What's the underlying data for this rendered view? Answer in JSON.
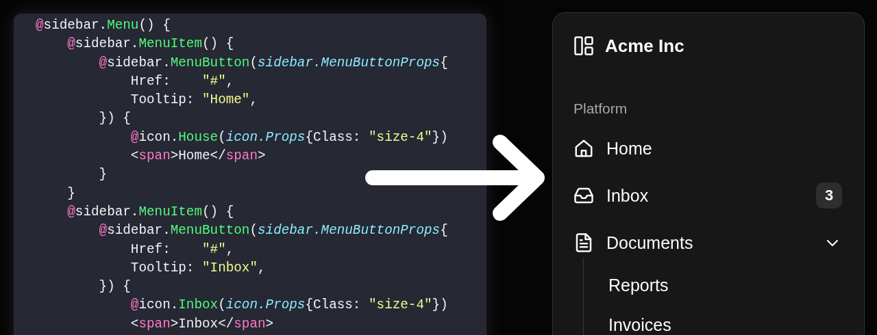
{
  "code_lines": [
    [
      {
        "kind": "at",
        "text": "@"
      },
      {
        "kind": "plain",
        "text": "sidebar."
      },
      {
        "kind": "fn",
        "text": "Menu"
      },
      {
        "kind": "plain",
        "text": "() {"
      }
    ],
    [
      {
        "kind": "at",
        "text": "    @"
      },
      {
        "kind": "plain",
        "text": "sidebar."
      },
      {
        "kind": "fn",
        "text": "MenuItem"
      },
      {
        "kind": "plain",
        "text": "() {"
      }
    ],
    [
      {
        "kind": "at",
        "text": "        @"
      },
      {
        "kind": "plain",
        "text": "sidebar."
      },
      {
        "kind": "fn",
        "text": "MenuButton"
      },
      {
        "kind": "plain",
        "text": "("
      },
      {
        "kind": "type",
        "text": "sidebar.MenuButtonProps"
      },
      {
        "kind": "plain",
        "text": "{"
      }
    ],
    [
      {
        "kind": "plain",
        "text": "            Href:    "
      },
      {
        "kind": "string",
        "text": "\"#\""
      },
      {
        "kind": "plain",
        "text": ","
      }
    ],
    [
      {
        "kind": "plain",
        "text": "            Tooltip: "
      },
      {
        "kind": "string",
        "text": "\"Home\""
      },
      {
        "kind": "plain",
        "text": ","
      }
    ],
    [
      {
        "kind": "plain",
        "text": "        }) {"
      }
    ],
    [
      {
        "kind": "at",
        "text": "            @"
      },
      {
        "kind": "plain",
        "text": "icon."
      },
      {
        "kind": "fn",
        "text": "House"
      },
      {
        "kind": "plain",
        "text": "("
      },
      {
        "kind": "type",
        "text": "icon.Props"
      },
      {
        "kind": "plain",
        "text": "{Class: "
      },
      {
        "kind": "string",
        "text": "\"size-4\""
      },
      {
        "kind": "plain",
        "text": "})"
      }
    ],
    [
      {
        "kind": "plain",
        "text": "            <"
      },
      {
        "kind": "tag",
        "text": "span"
      },
      {
        "kind": "plain",
        "text": ">Home</"
      },
      {
        "kind": "tag",
        "text": "span"
      },
      {
        "kind": "plain",
        "text": ">"
      }
    ],
    [
      {
        "kind": "plain",
        "text": "        }"
      }
    ],
    [
      {
        "kind": "plain",
        "text": "    }"
      }
    ],
    [
      {
        "kind": "at",
        "text": "    @"
      },
      {
        "kind": "plain",
        "text": "sidebar."
      },
      {
        "kind": "fn",
        "text": "MenuItem"
      },
      {
        "kind": "plain",
        "text": "() {"
      }
    ],
    [
      {
        "kind": "at",
        "text": "        @"
      },
      {
        "kind": "plain",
        "text": "sidebar."
      },
      {
        "kind": "fn",
        "text": "MenuButton"
      },
      {
        "kind": "plain",
        "text": "("
      },
      {
        "kind": "type",
        "text": "sidebar.MenuButtonProps"
      },
      {
        "kind": "plain",
        "text": "{"
      }
    ],
    [
      {
        "kind": "plain",
        "text": "            Href:    "
      },
      {
        "kind": "string",
        "text": "\"#\""
      },
      {
        "kind": "plain",
        "text": ","
      }
    ],
    [
      {
        "kind": "plain",
        "text": "            Tooltip: "
      },
      {
        "kind": "string",
        "text": "\"Inbox\""
      },
      {
        "kind": "plain",
        "text": ","
      }
    ],
    [
      {
        "kind": "plain",
        "text": "        }) {"
      }
    ],
    [
      {
        "kind": "at",
        "text": "            @"
      },
      {
        "kind": "plain",
        "text": "icon."
      },
      {
        "kind": "fn",
        "text": "Inbox"
      },
      {
        "kind": "plain",
        "text": "("
      },
      {
        "kind": "type",
        "text": "icon.Props"
      },
      {
        "kind": "plain",
        "text": "{Class: "
      },
      {
        "kind": "string",
        "text": "\"size-4\""
      },
      {
        "kind": "plain",
        "text": "})"
      }
    ],
    [
      {
        "kind": "plain",
        "text": "            <"
      },
      {
        "kind": "tag",
        "text": "span"
      },
      {
        "kind": "plain",
        "text": ">Inbox</"
      },
      {
        "kind": "tag",
        "text": "span"
      },
      {
        "kind": "plain",
        "text": ">"
      }
    ]
  ],
  "sidebar": {
    "brand": "Acme Inc",
    "group_label": "Platform",
    "items": [
      {
        "kind": "home",
        "label": "Home"
      },
      {
        "kind": "inbox",
        "label": "Inbox",
        "badge": "3"
      },
      {
        "kind": "documents",
        "label": "Documents",
        "expanded": true,
        "children": [
          {
            "label": "Reports"
          },
          {
            "label": "Invoices"
          }
        ]
      }
    ]
  }
}
